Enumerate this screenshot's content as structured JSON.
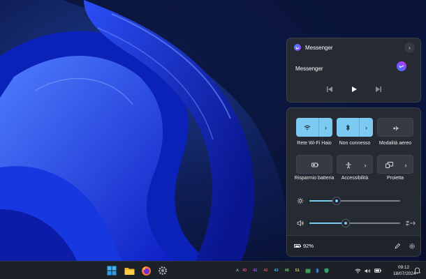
{
  "media": {
    "app_name": "Messenger",
    "title": "Messenger",
    "icons": [
      "messenger-icon",
      "chevron-right-icon",
      "previous-track-icon",
      "play-icon",
      "next-track-icon"
    ]
  },
  "quick_settings": {
    "tiles": [
      {
        "label": "Rete Wi-Fi Haio",
        "icon": "wifi-icon",
        "active": true
      },
      {
        "label": "Non connesso",
        "icon": "bluetooth-icon",
        "active": true
      },
      {
        "label": "Modalità aereo",
        "icon": "airplane-icon",
        "active": false
      },
      {
        "label": "Risparmio batteria",
        "icon": "battery-saver-icon",
        "active": false
      },
      {
        "label": "Accessibilità",
        "icon": "accessibility-icon",
        "active": false
      },
      {
        "label": "Proietta",
        "icon": "cast-icon",
        "active": false
      }
    ],
    "brightness": 0.3,
    "volume": 0.4,
    "battery": "92%"
  },
  "taskbar": {
    "apps": [
      "start-icon",
      "file-explorer-icon",
      "firefox-icon",
      "settings-icon"
    ],
    "tray_numbers": [
      "43",
      "41",
      "42",
      "43",
      "48",
      "51"
    ],
    "tray_colors": [
      "#e84a8a",
      "#8a5cf0",
      "#e04848",
      "#4aa8f0",
      "#58d068",
      "#e8c048"
    ],
    "time": "09:12",
    "date": "18/07/2024"
  },
  "colors": {
    "accent": "#7cc9f2",
    "panel": "#262a33",
    "taskbar": "#1c2027"
  }
}
